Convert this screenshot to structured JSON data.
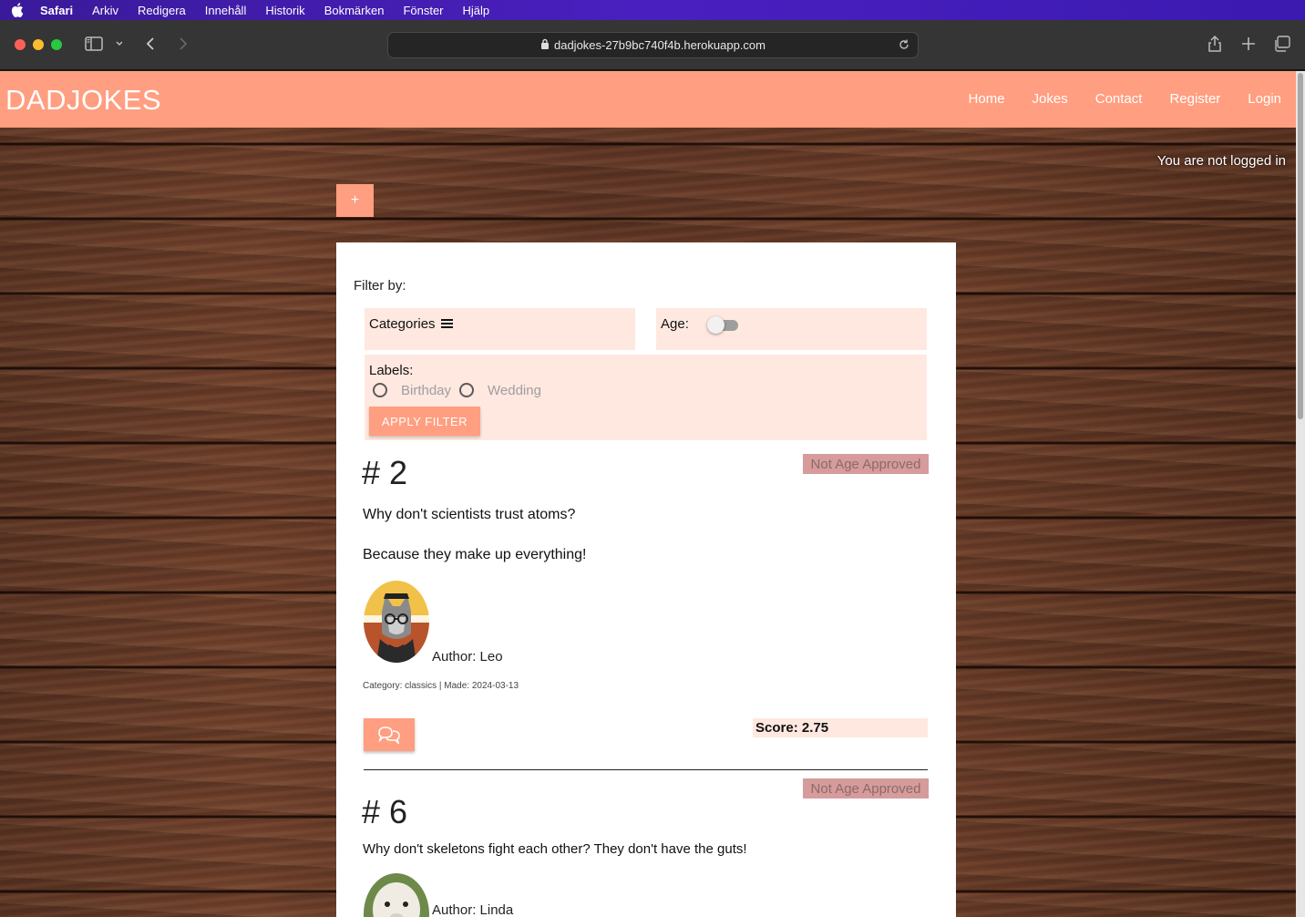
{
  "menubar": {
    "app": "Safari",
    "items": [
      "Arkiv",
      "Redigera",
      "Innehåll",
      "Historik",
      "Bokmärken",
      "Fönster",
      "Hjälp"
    ]
  },
  "browser": {
    "url": "dadjokes-27b9bc740f4b.herokuapp.com"
  },
  "site": {
    "brand": "DADJOKES",
    "nav": [
      "Home",
      "Jokes",
      "Contact",
      "Register",
      "Login"
    ],
    "login_status": "You are not logged in",
    "add_label": "+"
  },
  "filter": {
    "title": "Filter by:",
    "categories_label": "Categories",
    "age_label": "Age:",
    "age_enabled": false,
    "labels_label": "Labels:",
    "labels": [
      "Birthday",
      "Wedding"
    ],
    "apply_label": "APPLY FILTER"
  },
  "jokes": [
    {
      "id": "# 2",
      "badge": "Not Age Approved",
      "question": "Why don't scientists trust atoms?",
      "answer": "Because they make up everything!",
      "author": "Author: Leo",
      "meta": "Category: classics | Made: 2024-03-13",
      "score": "Score: 2.75"
    },
    {
      "id": "# 6",
      "badge": "Not Age Approved",
      "text": "Why don't skeletons fight each other? They don't have the guts!",
      "author": "Author: Linda"
    }
  ],
  "colors": {
    "accent": "#ff9e80",
    "panel": "#ffe8e0",
    "badge": "#d69b9b"
  }
}
